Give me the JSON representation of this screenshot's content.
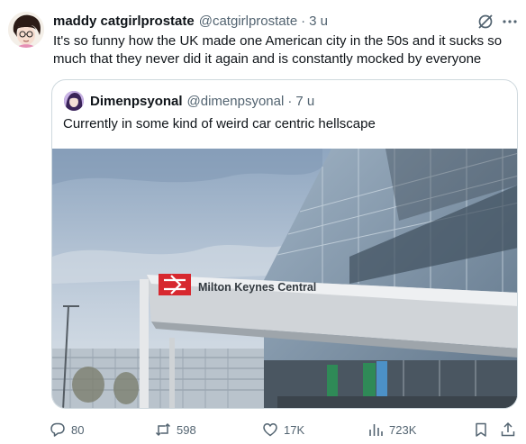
{
  "tweet": {
    "display_name": "maddy catgirlprostate",
    "handle": "@catgirlprostate",
    "separator": "·",
    "time": "3 u",
    "text": "It's so funny how the UK made one American city in the 50s and it sucks so much that they never did it again and is constantly mocked by everyone"
  },
  "quote": {
    "display_name": "Dimenpsyonal",
    "handle": "@dimenpsyonal",
    "separator": "·",
    "time": "7 u",
    "text": "Currently in some kind of weird car centric hellscape",
    "image": {
      "sign_text": "Milton Keynes Central"
    }
  },
  "actions": {
    "replies": "80",
    "retweets": "598",
    "likes": "17K",
    "views": "723K"
  },
  "icons": {
    "grok": "grok-icon",
    "more": "more-icon",
    "reply": "reply-icon",
    "retweet": "retweet-icon",
    "like": "heart-icon",
    "views": "views-icon",
    "bookmark": "bookmark-icon",
    "share": "share-icon"
  },
  "colors": {
    "secondary_text": "#536471",
    "border": "#cfd9de",
    "rail_red": "#d7282f"
  }
}
